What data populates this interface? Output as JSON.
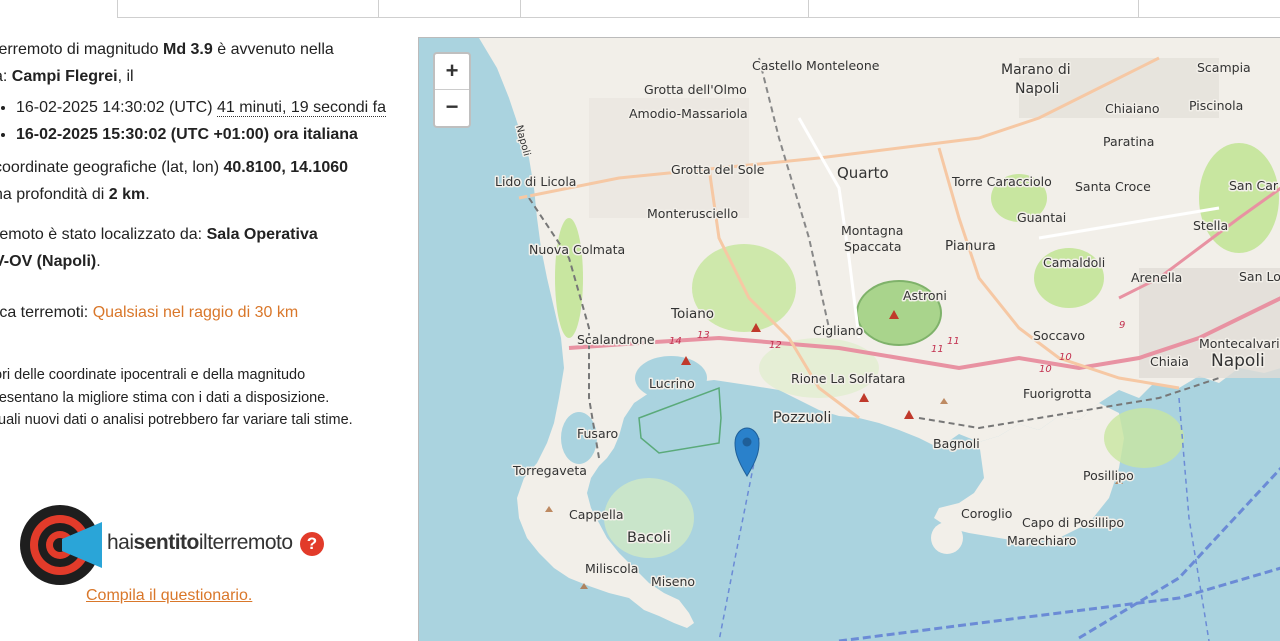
{
  "info": {
    "line1_prefix": "terremoto di magnitudo",
    "magnitude": "Md 3.9",
    "line1_suffix": "è avvenuto nella",
    "zone_prefix": "a:",
    "zone": "Campi Flegrei",
    "zone_suffix": ", il",
    "utc_time": "16-02-2025 14:30:02 (UTC)",
    "relative_time": "41 minuti, 19 secondi fa",
    "local_time": "16-02-2025 15:30:02 (UTC +01:00) ora italiana",
    "coords_prefix": "coordinate geografiche (lat, lon)",
    "coords": "40.8100, 14.1060",
    "depth_prefix": "na profondità di",
    "depth": "2 km",
    "located_prefix": "remoto è stato localizzato da:",
    "located_by": "Sala Operativa",
    "located_by_2": "V-OV (Napoli)",
    "search_prefix": "rca terremoti:",
    "search_link": "Qualsiasi nel raggio di 30 km",
    "disclaimer_1": "ori delle coordinate ipocentrali e della magnitudo",
    "disclaimer_2": "resentano la migliore stima con i dati a disposizione.",
    "disclaimer_3": "tuali nuovi dati o analisi potrebbero far variare tali stime."
  },
  "hst": {
    "text_thin": "hai",
    "text_bold": "sentito",
    "text_rest": "ilterremoto",
    "question": "?",
    "cta": "Compila il questionario."
  },
  "map": {
    "zoom_in": "+",
    "zoom_out": "−",
    "marker_icon": "map-pin-icon",
    "colors": {
      "sea": "#aad3df",
      "land": "#f2efe9",
      "green": "#c8e6a0",
      "road_primary": "#f6c8a4",
      "road_secondary": "#e892a2",
      "marker": "#2a81cb"
    },
    "labels": {
      "castello": "Castello Monteleone",
      "marano": "Marano di",
      "marano2": "Napoli",
      "scampia": "Scampia",
      "grotta_olmo": "Grotta dell'Olmo",
      "amodio": "Amodio-Massariola",
      "chiaiano": "Chiaiano",
      "piscinola": "Piscinola",
      "paratina": "Paratina",
      "lido": "Lido di Licola",
      "grotta_sole": "Grotta del Sole",
      "quarto": "Quarto",
      "torre_caracciolo": "Torre Caracciolo",
      "santa_croce": "Santa Croce",
      "san_car": "San Car",
      "monterusciello": "Monterusciello",
      "guantai": "Guantai",
      "stella": "Stella",
      "nuova_colmata": "Nuova Colmata",
      "montagna": "Montagna",
      "spaccata": "Spaccata",
      "pianura": "Pianura",
      "camaldoli": "Camaldoli",
      "arenella": "Arenella",
      "san_lo": "San Lo",
      "astroni": "Astroni",
      "toiano": "Toiano",
      "cigliano": "Cigliano",
      "soccavo": "Soccavo",
      "montecalvario": "Montecalvario",
      "scalandrone": "Scalandrone",
      "chiaia": "Chiaia",
      "napoli": "Napoli",
      "lucrino": "Lucrino",
      "rione": "Rione La Solfatara",
      "fuorigrotta": "Fuorigrotta",
      "pozzuoli": "Pozzuoli",
      "fusaro": "Fusaro",
      "bagnoli": "Bagnoli",
      "torregaveta": "Torregaveta",
      "posillipo": "Posillipo",
      "cappella": "Cappella",
      "coroglio": "Coroglio",
      "capo": "Capo di Posillipo",
      "bacoli": "Bacoli",
      "marechiaro": "Marechiaro",
      "miliscola": "Miliscola",
      "miseno": "Miseno",
      "napoli_road": "Napoli",
      "r14": "14",
      "r13": "13",
      "r12": "12",
      "r11": "11",
      "r10": "10",
      "r9": "9"
    }
  }
}
